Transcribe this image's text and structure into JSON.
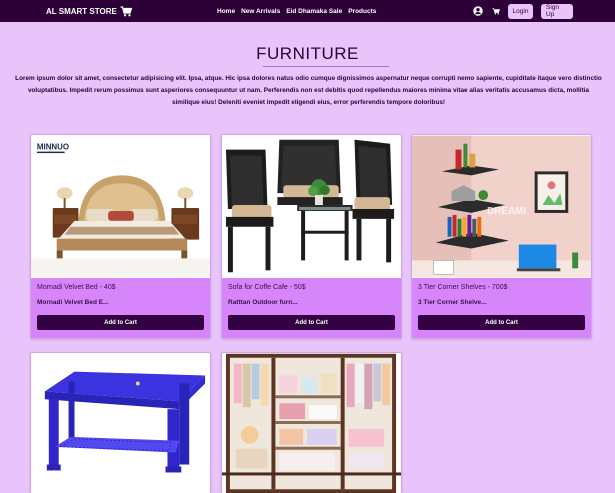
{
  "nav": {
    "brand": "AL SMART STORE",
    "links": [
      "Home",
      "New Arrivals",
      "Eid Dhamaka Sale",
      "Products"
    ],
    "login": "Login",
    "signup": "Sign Up"
  },
  "page": {
    "title": "FURNITURE",
    "intro": "Lorem ipsum dolor sit amet, consectetur adipisicing elit. Ipsa, atque. Hic ipsa dolores natus odio cumque dignissimos aspernatur neque corrupti nemo sapiente, cupiditate itaque vero distinctio voluptatibus. Impedit rerum possimus sunt asperiores consequuntur ut nam. Perferendis non est debitis quod repellendus maiores minima vitae alias veritatis accusamus dicta, mollitia similique eius! Deleniti eveniet impedit eligendi eius, error perferendis tempore doloribus!"
  },
  "products": [
    {
      "name": "Mornadi Velvet Bed - 40$",
      "desc": "Mornadi Velvet Bed E...",
      "button": "Add to Cart",
      "image_logo": "MINNUO"
    },
    {
      "name": "Sofa for Coffe Cafe - 50$",
      "desc": "Ratttan Outdoor furn...",
      "button": "Add to Cart"
    },
    {
      "name": "3 Tier Corner Shelves - 700$",
      "desc": "3 Tier Corner Shelve...",
      "button": "Add to Cart",
      "image_watermark": "DREAMI"
    },
    {
      "name": "",
      "desc": "",
      "button": ""
    },
    {
      "name": "",
      "desc": "",
      "button": ""
    }
  ],
  "colors": {
    "page_bg": "#e8c4fb",
    "navbar_bg": "#2d0038",
    "card_bg": "#d685fb",
    "button_bg": "#330042"
  },
  "icons": [
    "cart-icon",
    "user-icon",
    "cart-icon-small"
  ]
}
